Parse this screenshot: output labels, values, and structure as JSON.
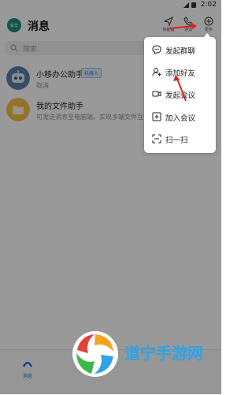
{
  "status_bar": {
    "time": "2:02"
  },
  "header": {
    "avatar_text": "新华",
    "title": "消息",
    "actions": [
      {
        "label": "快捷键",
        "icon": "send-icon"
      },
      {
        "label": "通话",
        "icon": "phone-icon"
      },
      {
        "label": "更多",
        "icon": "plus-circle-icon"
      }
    ]
  },
  "search": {
    "placeholder": "搜索"
  },
  "conversations": [
    {
      "title": "小移办公助手",
      "badge": "机器人",
      "subtitle": "取消",
      "icon": "robot-icon"
    },
    {
      "title": "我的文件助手",
      "subtitle": "可发送消息至电脑端，实现多端文件互传",
      "icon": "folder-icon"
    }
  ],
  "menu": {
    "items": [
      {
        "label": "发起群聊",
        "icon": "chat-bubble-icon"
      },
      {
        "label": "添加好友",
        "icon": "add-user-icon"
      },
      {
        "label": "发起会议",
        "icon": "video-icon"
      },
      {
        "label": "加入会议",
        "icon": "plus-square-icon"
      },
      {
        "label": "扫一扫",
        "icon": "scan-icon"
      }
    ]
  },
  "bottom_nav": {
    "messages_label": "消息"
  },
  "watermark": {
    "text": "道宁手游网"
  },
  "colors": {
    "accent": "#1a73e8",
    "arrow": "#e02020",
    "watermark": "#2ea4e6"
  }
}
